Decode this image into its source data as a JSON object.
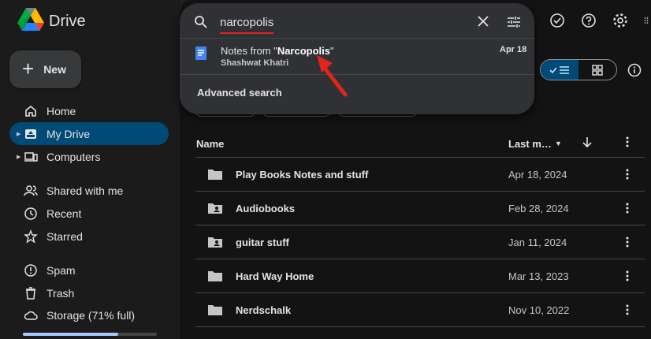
{
  "app": {
    "name": "Drive",
    "logo_icon": "google-drive-logo"
  },
  "sidebar": {
    "new_label": "New",
    "items": [
      {
        "label": "Home",
        "icon": "home-icon",
        "active": false
      },
      {
        "label": "My Drive",
        "icon": "my-drive-icon",
        "active": true
      },
      {
        "label": "Computers",
        "icon": "computers-icon",
        "active": false
      },
      {
        "label": "Shared with me",
        "icon": "shared-icon",
        "active": false
      },
      {
        "label": "Recent",
        "icon": "clock-icon",
        "active": false
      },
      {
        "label": "Starred",
        "icon": "star-icon",
        "active": false
      },
      {
        "label": "Spam",
        "icon": "spam-icon",
        "active": false
      },
      {
        "label": "Trash",
        "icon": "trash-icon",
        "active": false
      },
      {
        "label": "Storage (71% full)",
        "icon": "cloud-icon",
        "active": false
      }
    ],
    "storage_fraction": 0.71
  },
  "search": {
    "value": "narcopolis",
    "result": {
      "title_prefix": "Notes from \"",
      "title_bold": "Narcopolis",
      "title_suffix": "\"",
      "owner": "Shashwat Khatri",
      "date": "Apr 18"
    },
    "advanced_label": "Advanced search"
  },
  "list": {
    "header_name": "Name",
    "header_modified": "Last m…",
    "rows": [
      {
        "name": "Play Books Notes and stuff",
        "date": "Apr 18, 2024",
        "shared": false
      },
      {
        "name": "Audiobooks",
        "date": "Feb 28, 2024",
        "shared": true
      },
      {
        "name": "guitar stuff",
        "date": "Jan 11, 2024",
        "shared": true
      },
      {
        "name": "Hard Way Home",
        "date": "Mar 13, 2023",
        "shared": false
      },
      {
        "name": "Nerdschalk",
        "date": "Nov 10, 2022",
        "shared": false
      }
    ]
  },
  "colors": {
    "accent": "#a8c7fa",
    "active_nav": "#004a77",
    "annotation_red": "#e1251b"
  }
}
